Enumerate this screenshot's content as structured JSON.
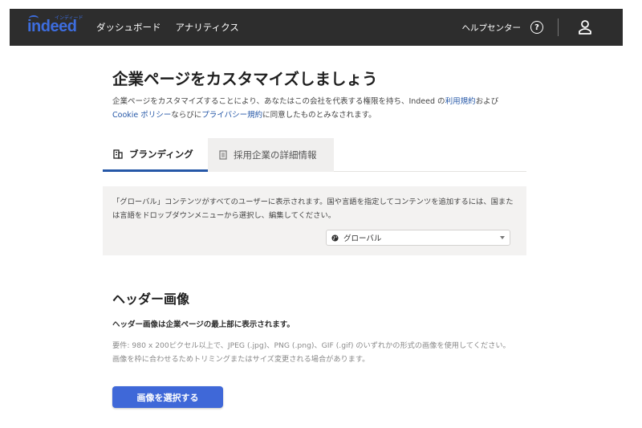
{
  "header": {
    "logo_text": "indeed",
    "logo_kana": "インディード",
    "nav": [
      "ダッシュボード",
      "アナリティクス"
    ],
    "help_label": "ヘルプセンター",
    "help_icon_glyph": "?",
    "accent_color": "#3d6dde",
    "bar_color": "#2d2d2d"
  },
  "page": {
    "title": "企業ページをカスタマイズしましょう",
    "intro_part1": "企業ページをカスタマイズすることにより、あなたはこの会社を代表する権限を持ち、Indeed の",
    "terms_link": "利用規約",
    "intro_part2": "および",
    "cookie_link": "Cookie ポリシー",
    "intro_part3": "ならびに",
    "privacy_link": "プライバシー規約",
    "intro_part4": "に同意したものとみなされます。"
  },
  "tabs": [
    {
      "label": "ブランディング",
      "icon": "building-icon",
      "active": true
    },
    {
      "label": "採用企業の詳細情報",
      "icon": "document-icon",
      "active": false
    }
  ],
  "notice": {
    "text": "「グローバル」コンテンツがすべてのユーザーに表示されます。国や言語を指定してコンテンツを追加するには、国または言語をドロップダウンメニューから選択し、編集してください。",
    "select_value": "グローバル"
  },
  "header_image": {
    "title": "ヘッダー画像",
    "description": "ヘッダー画像は企業ページの最上部に表示されます。",
    "requirement_line1": "要件: 980 x 200ピクセル以上で、JPEG (.jpg)、PNG (.png)、GIF (.gif) のいずれかの形式の画像を使用してください。",
    "requirement_line2": "画像を枠に合わせるためトリミングまたはサイズ変更される場合があります。",
    "button_label": "画像を選択する",
    "button_color": "#3f68d8"
  },
  "link_color": "#2557a7"
}
